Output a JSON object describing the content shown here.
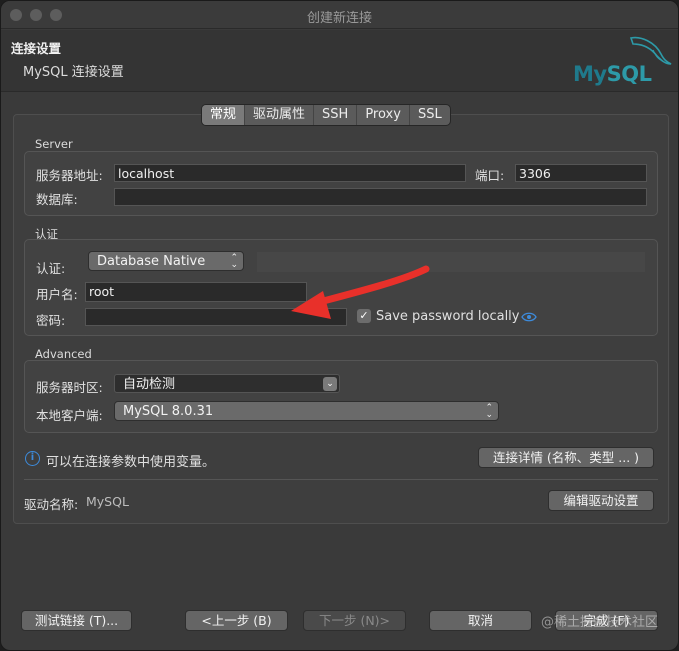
{
  "window": {
    "title": "创建新连接"
  },
  "header": {
    "title": "连接设置",
    "subtitle": "MySQL 连接设置",
    "logo": {
      "text_a": "My",
      "text_b": "SQL"
    }
  },
  "tabs": [
    {
      "label": "常规",
      "active": true
    },
    {
      "label": "驱动属性",
      "active": false
    },
    {
      "label": "SSH",
      "active": false
    },
    {
      "label": "Proxy",
      "active": false
    },
    {
      "label": "SSL",
      "active": false
    }
  ],
  "server": {
    "group_label": "Server",
    "host_label": "服务器地址:",
    "host_value": "localhost",
    "port_label": "端口:",
    "port_value": "3306",
    "db_label": "数据库:",
    "db_value": ""
  },
  "auth": {
    "group_label": "认证",
    "auth_label": "认证:",
    "auth_value": "Database Native",
    "user_label": "用户名:",
    "user_value": "root",
    "pass_label": "密码:",
    "pass_value": "",
    "save_password_label": "Save password locally",
    "save_password_checked": true,
    "checkmark": "✓"
  },
  "advanced": {
    "group_label": "Advanced",
    "timezone_label": "服务器时区:",
    "timezone_value": "自动检测",
    "client_label": "本地客户端:",
    "client_value": "MySQL 8.0.31"
  },
  "info": {
    "icon_text": "i",
    "text": "可以在连接参数中使用变量。",
    "details_button": "连接详情 (名称、类型 ... )"
  },
  "driver": {
    "label": "驱动名称:",
    "value": "MySQL",
    "edit_button": "编辑驱动设置"
  },
  "footer": {
    "test_button": "测试链接 (T)...",
    "back_button": "<上一步 (B)",
    "next_button": "下一步 (N)>",
    "cancel_button": "取消",
    "finish_button": "完成 (F)"
  },
  "watermark": "@稀土掘金技术社区",
  "colors": {
    "arrow": "#e8302a",
    "info": "#3d8bdb",
    "logo": "#1f7a8c"
  }
}
